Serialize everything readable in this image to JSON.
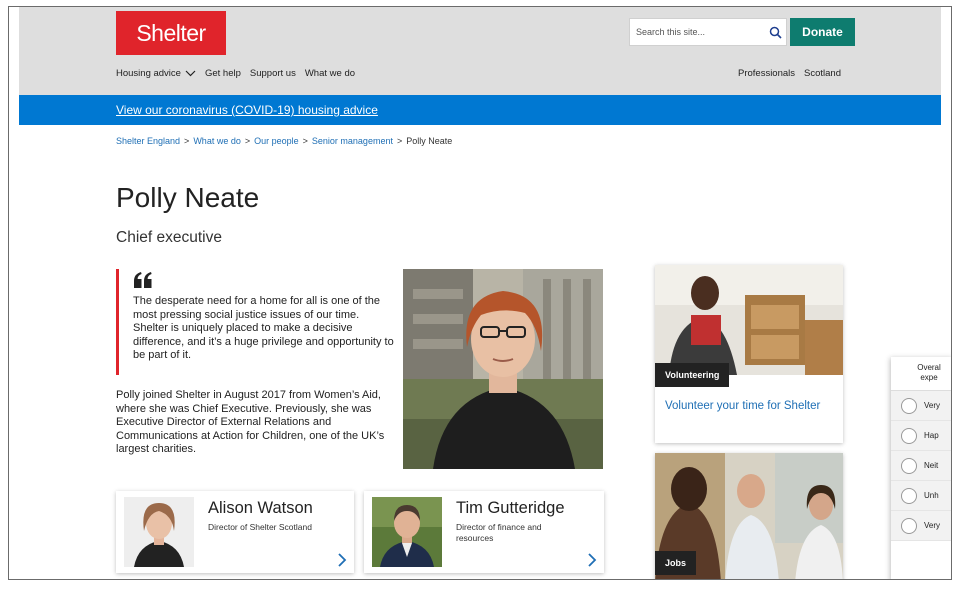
{
  "header": {
    "logo": "Shelter",
    "search_placeholder": "Search this site...",
    "donate": "Donate",
    "nav": [
      "Housing advice",
      "Get help",
      "Support us",
      "What we do"
    ],
    "nav_right": [
      "Professionals",
      "Scotland"
    ]
  },
  "banner": {
    "link": "View our coronavirus (COVID-19) housing advice"
  },
  "breadcrumb": {
    "items": [
      "Shelter England",
      "What we do",
      "Our people",
      "Senior management"
    ],
    "current": "Polly Neate",
    "separator": ">"
  },
  "page": {
    "title": "Polly Neate",
    "subtitle": "Chief executive",
    "quote_mark": "66",
    "quote": "The desperate need for a home for all is one of the most pressing social justice issues of our time. Shelter is uniquely placed to make a decisive difference, and it’s a huge privilege and opportunity to be part of it.",
    "bio": "Polly joined Shelter in August 2017 from Women’s Aid, where she was Chief Executive. Previously, she was Executive Director of External Relations and Communications at Action for Children, one of the UK’s largest charities."
  },
  "people": [
    {
      "name": "Alison Watson",
      "role": "Director of Shelter Scotland"
    },
    {
      "name": "Tim Gutteridge",
      "role": "Director of finance and resources"
    }
  ],
  "side_cards": [
    {
      "tag": "Volunteering",
      "link": "Volunteer your time for Shelter"
    },
    {
      "tag": "Jobs"
    }
  ],
  "feedback": {
    "heading_line1": "Overal",
    "heading_line2": "expe",
    "options": [
      "Very",
      "Hap",
      "Neit",
      "Unh",
      "Very"
    ]
  },
  "colors": {
    "brand_red": "#e0242b",
    "donate_green": "#0e7c6f",
    "banner_blue": "#0078d2",
    "link_blue": "#1f6fb5"
  }
}
